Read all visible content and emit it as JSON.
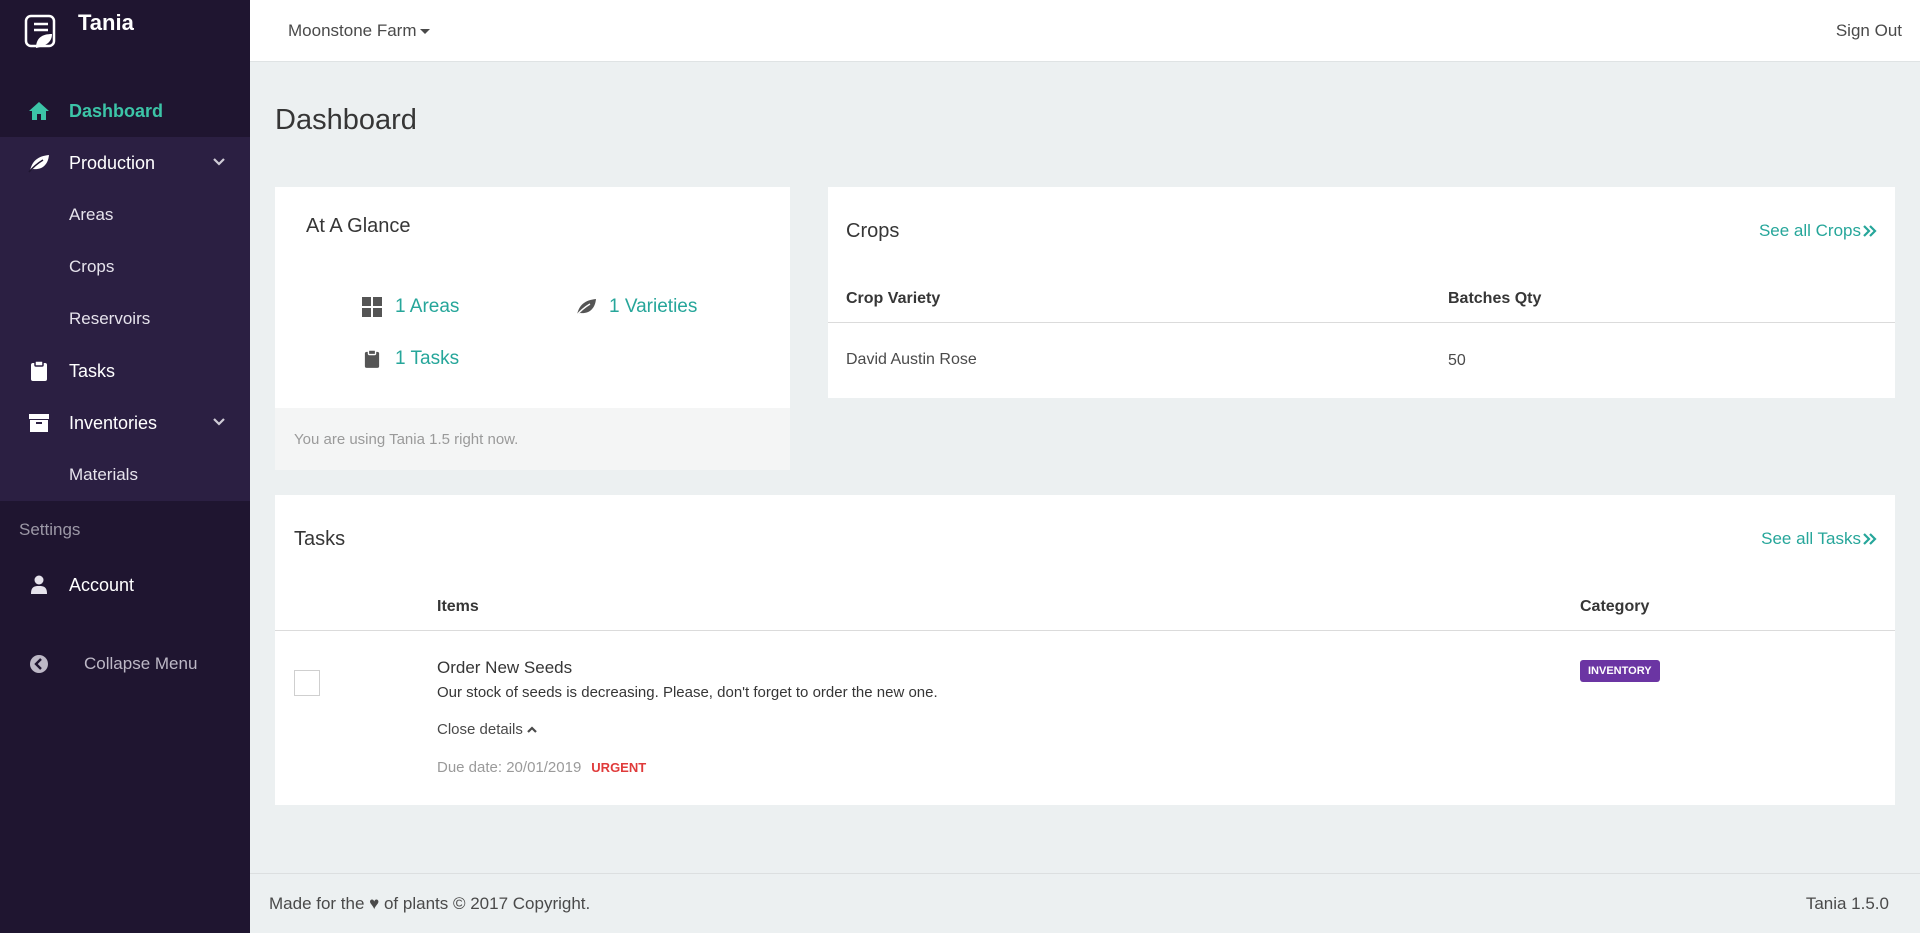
{
  "brand": {
    "name": "Tania"
  },
  "sidebar": {
    "items": [
      {
        "label": "Dashboard",
        "icon": "home-icon"
      },
      {
        "label": "Production",
        "icon": "leaf-icon",
        "sub": [
          "Areas",
          "Crops",
          "Reservoirs"
        ]
      },
      {
        "label": "Tasks",
        "icon": "clipboard-icon"
      },
      {
        "label": "Inventories",
        "icon": "archive-icon",
        "sub": [
          "Materials"
        ]
      }
    ],
    "settings_label": "Settings",
    "account_label": "Account",
    "collapse_label": "Collapse Menu"
  },
  "topbar": {
    "farm": "Moonstone Farm",
    "signout": "Sign Out"
  },
  "main": {
    "title": "Dashboard",
    "glance": {
      "title": "At A Glance",
      "areas": "1 Areas",
      "varieties": "1 Varieties",
      "tasks": "1 Tasks",
      "footer": "You are using Tania 1.5 right now."
    },
    "crops": {
      "title": "Crops",
      "see_all": "See all Crops",
      "headers": [
        "Crop Variety",
        "Batches Qty"
      ],
      "rows": [
        {
          "variety": "David Austin Rose",
          "qty": "50"
        }
      ]
    },
    "tasks": {
      "title": "Tasks",
      "see_all": "See all Tasks",
      "headers": [
        "Items",
        "Category"
      ],
      "rows": [
        {
          "title": "Order New Seeds",
          "description": "Our stock of seeds is decreasing. Please, don't forget to order the new one.",
          "close_details": "Close details",
          "due": "Due date: 20/01/2019",
          "priority": "URGENT",
          "category": "INVENTORY"
        }
      ]
    }
  },
  "footer": {
    "left": "Made for the ♥ of plants © 2017 Copyright.",
    "right": "Tania 1.5.0"
  },
  "colors": {
    "accent": "#3cc4a7",
    "link": "#26a69a",
    "sidebar_bg": "#1f1530",
    "badge": "#6b35a3",
    "urgent": "#e03b3b"
  }
}
